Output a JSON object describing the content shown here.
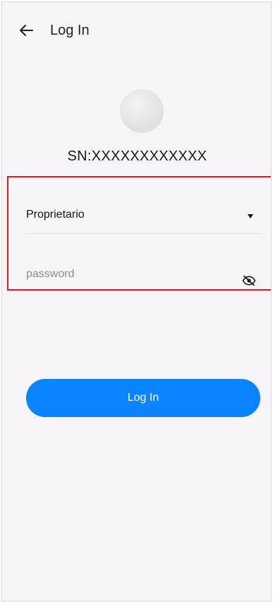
{
  "header": {
    "title": "Log In",
    "back_icon": "arrow-left-icon"
  },
  "device": {
    "serial": "SN:XXXXXXXXXXXX",
    "avatar_icon": "device-avatar"
  },
  "form": {
    "role": {
      "selected": "Proprietario",
      "dropdown_icon": "caret-down-icon"
    },
    "password": {
      "value": "",
      "placeholder": "password",
      "visibility_icon": "eye-off-icon"
    },
    "submit_label": "Log In"
  },
  "colors": {
    "background": "#f6f4f7",
    "primary_button": "#0a84ff",
    "highlight_border": "#e01b24",
    "text": "#1a1a1a"
  }
}
